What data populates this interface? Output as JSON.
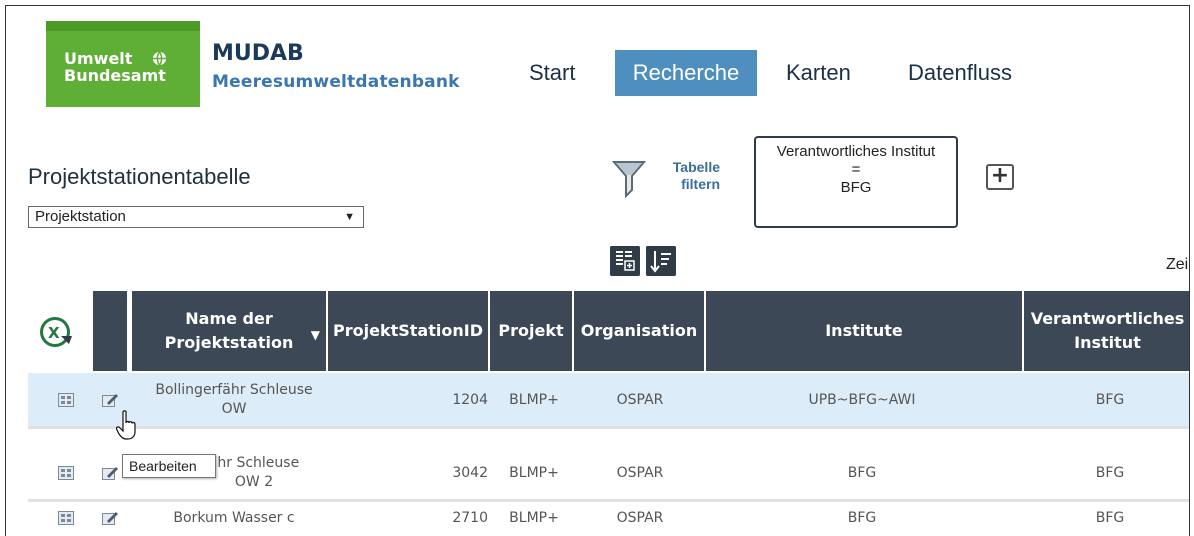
{
  "header": {
    "logo_line1": "Umwelt",
    "logo_line2": "Bundesamt",
    "app_title": "MUDAB",
    "app_subtitle": "Meeresumweltdatenbank",
    "nav": {
      "start": "Start",
      "recherche": "Recherche",
      "karten": "Karten",
      "datenfluss": "Datenfluss"
    },
    "colors": {
      "logo_green": "#5fae35",
      "nav_active": "#4f8fc0",
      "title_dark": "#1b3a5a",
      "subtitle_blue": "#3a76b0"
    }
  },
  "page": {
    "title": "Projektstationentabelle",
    "select_value": "Projektstation"
  },
  "filter": {
    "label_line1": "Tabelle",
    "label_line2": "filtern",
    "condition_field": "Verantwortliches Institut",
    "condition_operator": "=",
    "condition_value": "BFG",
    "add_label": "+"
  },
  "toolbar": {
    "zeilen_label": "Zei"
  },
  "table": {
    "headers": {
      "name_line1": "Name der",
      "name_line2": "Projektstation",
      "id": "ProjektStationID",
      "projekt": "Projekt",
      "organisation": "Organisation",
      "institute": "Institute",
      "verant_line1": "Verantwortliches",
      "verant_line2": "Institut"
    },
    "rows": [
      {
        "name_line1": "Bollingerfähr Schleuse",
        "name_line2": "OW",
        "id": "1204",
        "projekt": "BLMP+",
        "organisation": "OSPAR",
        "institute": "UPB~BFG~AWI",
        "verant": "BFG"
      },
      {
        "name_line1": "ähr Schleuse",
        "name_line2": "OW 2",
        "id": "3042",
        "projekt": "BLMP+",
        "organisation": "OSPAR",
        "institute": "BFG",
        "verant": "BFG"
      },
      {
        "name_line1": "Borkum Wasser c",
        "name_line2": "",
        "id": "2710",
        "projekt": "BLMP+",
        "organisation": "OSPAR",
        "institute": "BFG",
        "verant": "BFG"
      }
    ],
    "header_color": "#3c4856",
    "selected_row_color": "#dcecf8"
  },
  "tooltip": {
    "text": "Bearbeiten"
  }
}
